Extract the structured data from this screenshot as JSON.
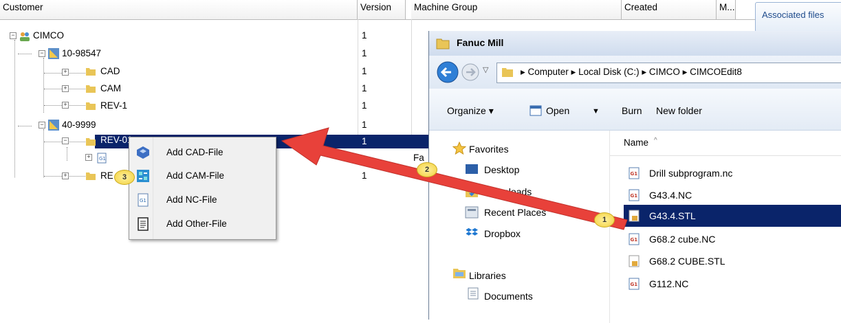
{
  "grid": {
    "columns": [
      "Customer",
      "Version",
      "Machine Group",
      "Created",
      "M..."
    ],
    "associated_files_tab": "Associated files",
    "tree": [
      {
        "label": "CIMCO",
        "version": "1"
      },
      {
        "label": "10-98547",
        "version": "1"
      },
      {
        "label": "CAD",
        "version": "1"
      },
      {
        "label": "CAM",
        "version": "1"
      },
      {
        "label": "REV-1",
        "version": "1"
      },
      {
        "label": "40-9999",
        "version": "1"
      },
      {
        "label": "REV-01",
        "version": "1"
      },
      {
        "label": "",
        "version": ""
      },
      {
        "label": "RE",
        "version": "1"
      }
    ],
    "partial_text": "Fa"
  },
  "context_menu": {
    "items": [
      {
        "label": "Add CAD-File",
        "icon": "cad-icon"
      },
      {
        "label": "Add CAM-File",
        "icon": "cam-icon"
      },
      {
        "label": "Add NC-File",
        "icon": "nc-file-icon"
      },
      {
        "label": "Add Other-File",
        "icon": "document-icon"
      }
    ]
  },
  "explorer": {
    "title": "Fanuc Mill",
    "breadcrumb": "▸ Computer ▸ Local Disk (C:) ▸ CIMCO ▸ CIMCOEdit8",
    "toolbar": {
      "organize": "Organize ▾",
      "open": "Open",
      "burn": "Burn",
      "new_folder": "New folder"
    },
    "nav": {
      "favorites": "Favorites",
      "items": [
        "Desktop",
        "Downloads",
        "Recent Places",
        "Dropbox"
      ],
      "libraries": "Libraries",
      "lib_items": [
        "Documents"
      ]
    },
    "name_column": "Name",
    "files": [
      {
        "name": "Drill subprogram.nc",
        "type": "nc"
      },
      {
        "name": "G43.4.NC",
        "type": "nc"
      },
      {
        "name": "G43.4.STL",
        "type": "stl",
        "selected": true
      },
      {
        "name": "G68.2 cube.NC",
        "type": "nc"
      },
      {
        "name": "G68.2 CUBE.STL",
        "type": "stl"
      },
      {
        "name": "G112.NC",
        "type": "nc"
      }
    ]
  },
  "callouts": [
    "1",
    "2",
    "3"
  ],
  "colors": {
    "selection": "#0a246a",
    "arrow": "#e8413a",
    "badge": "#f2d03a"
  }
}
